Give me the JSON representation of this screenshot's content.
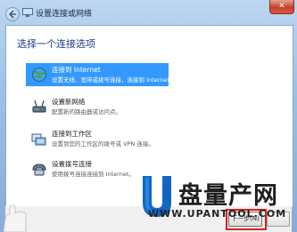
{
  "window": {
    "title": "设置连接或网络",
    "close_glyph": "✕"
  },
  "dialog": {
    "heading": "选择一个连接选项"
  },
  "options": [
    {
      "title": "连接到 Internet",
      "desc": "设置无线、宽带或拨号连接，连接到 Internet。",
      "icon": "globe-icon",
      "selected": true
    },
    {
      "title": "设置新网络",
      "desc": "配置新的路由器或访问点。",
      "icon": "router-icon",
      "selected": false
    },
    {
      "title": "连接到工作区",
      "desc": "设置到您的工作区的拨号或 VPN 连接。",
      "icon": "workplace-icon",
      "selected": false
    },
    {
      "title": "设置拨号连接",
      "desc": "使用拨号连接连接到 Internet。",
      "icon": "dialup-icon",
      "selected": false
    }
  ],
  "footer": {
    "next_label": "下一步(N)"
  },
  "watermark": {
    "text": "盘量产网",
    "url": "WWW.UPANTOOL.COM"
  },
  "colors": {
    "selection": "#3399ff",
    "heading": "#1e3a8a",
    "highlight": "#e01f1f"
  }
}
